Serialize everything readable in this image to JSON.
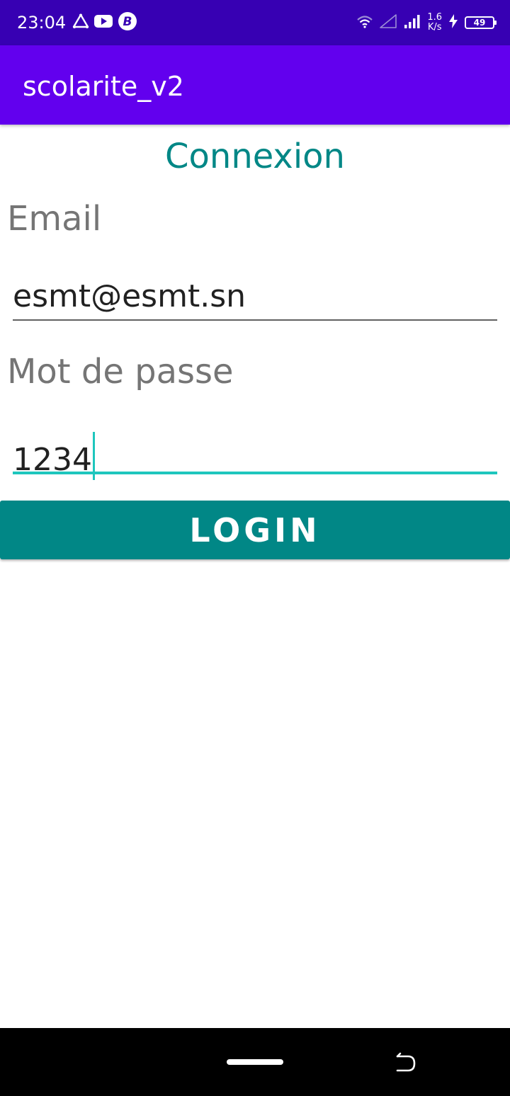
{
  "status_bar": {
    "time": "23:04",
    "left_icons": [
      "navigation-triangle-icon",
      "youtube-icon",
      "b-app-icon"
    ],
    "right_icons": [
      "wifi-icon",
      "signal-empty-icon",
      "signal-bars-icon",
      "charging-icon",
      "battery-icon"
    ],
    "net_speed_value": "1.6",
    "net_speed_unit": "K/s",
    "battery_level": "49"
  },
  "app_bar": {
    "title": "scolarite_v2"
  },
  "screen": {
    "heading": "Connexion"
  },
  "form": {
    "email_label": "Email",
    "email_value": "esmt@esmt.sn",
    "password_label": "Mot de passe",
    "password_value": "1234",
    "login_label": "LOGIN"
  },
  "colors": {
    "status_bar": "#3700b3",
    "app_bar": "#6200ee",
    "accent": "#018786",
    "focus_line": "#1ec6bd"
  }
}
